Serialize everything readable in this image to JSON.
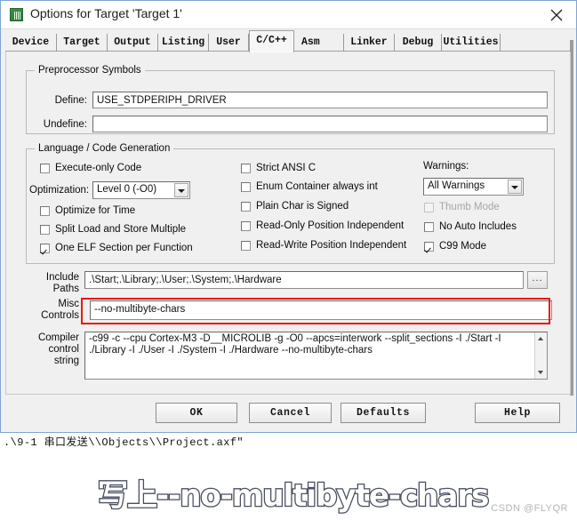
{
  "window": {
    "title": "Options for Target 'Target 1'",
    "icon": "keil-uvision-icon",
    "close_label": "✕"
  },
  "tabs": [
    {
      "label": "Device",
      "active": false
    },
    {
      "label": "Target",
      "active": false
    },
    {
      "label": "Output",
      "active": false
    },
    {
      "label": "Listing",
      "active": false
    },
    {
      "label": "User",
      "active": false
    },
    {
      "label": "C/C++",
      "active": true
    },
    {
      "label": "Asm",
      "active": false
    },
    {
      "label": "Linker",
      "active": false
    },
    {
      "label": "Debug",
      "active": false
    },
    {
      "label": "Utilities",
      "active": false
    }
  ],
  "preprocessor": {
    "group_title": "Preprocessor Symbols",
    "define_label": "Define:",
    "define_value": "USE_STDPERIPH_DRIVER",
    "undefine_label": "Undefine:",
    "undefine_value": ""
  },
  "language": {
    "group_title": "Language / Code Generation",
    "left_checks": [
      {
        "label": "Execute-only Code",
        "checked": false,
        "disabled": false
      },
      {
        "label": "Optimize for Time",
        "checked": false,
        "disabled": false
      },
      {
        "label": "Split Load and Store Multiple",
        "checked": false,
        "disabled": false
      },
      {
        "label": "One ELF Section per Function",
        "checked": true,
        "disabled": false
      }
    ],
    "middle_checks": [
      {
        "label": "Strict ANSI C",
        "checked": false,
        "disabled": false
      },
      {
        "label": "Enum Container always int",
        "checked": false,
        "disabled": false
      },
      {
        "label": "Plain Char is Signed",
        "checked": false,
        "disabled": false
      },
      {
        "label": "Read-Only Position Independent",
        "checked": false,
        "disabled": false
      },
      {
        "label": "Read-Write Position Independent",
        "checked": false,
        "disabled": false
      }
    ],
    "right_checks": [
      {
        "label": "Thumb Mode",
        "checked": false,
        "disabled": true
      },
      {
        "label": "No Auto Includes",
        "checked": false,
        "disabled": false
      },
      {
        "label": "C99 Mode",
        "checked": true,
        "disabled": false
      }
    ],
    "optimization_label": "Optimization:",
    "optimization_value": "Level 0 (-O0)",
    "warnings_label": "Warnings:",
    "warnings_value": "All Warnings"
  },
  "paths": {
    "include_label_line1": "Include",
    "include_label_line2": "Paths",
    "include_value": ".\\Start;.\\Library;.\\User;.\\System;.\\Hardware",
    "browse_label": "...",
    "misc_label_line1": "Misc",
    "misc_label_line2": "Controls",
    "misc_value": "--no-multibyte-chars",
    "misc_highlight_color": "#e8190f",
    "compiler_label_line1": "Compiler",
    "compiler_label_line2": "control",
    "compiler_label_line3": "string",
    "compiler_value": "-c99 -c --cpu Cortex-M3 -D__MICROLIB -g -O0 --apcs=interwork --split_sections -I ./Start -I ./Library -I ./User -I ./System -I ./Hardware --no-multibyte-chars"
  },
  "buttons": {
    "ok": "OK",
    "cancel": "Cancel",
    "defaults": "Defaults",
    "help": "Help"
  },
  "background": {
    "build_output_line": ".\\9-1 串口发送\\\\Objects\\\\Project.axf\""
  },
  "annotation": {
    "text": "写上--no-multibyte-chars",
    "watermark": "CSDN @FLYQR"
  }
}
